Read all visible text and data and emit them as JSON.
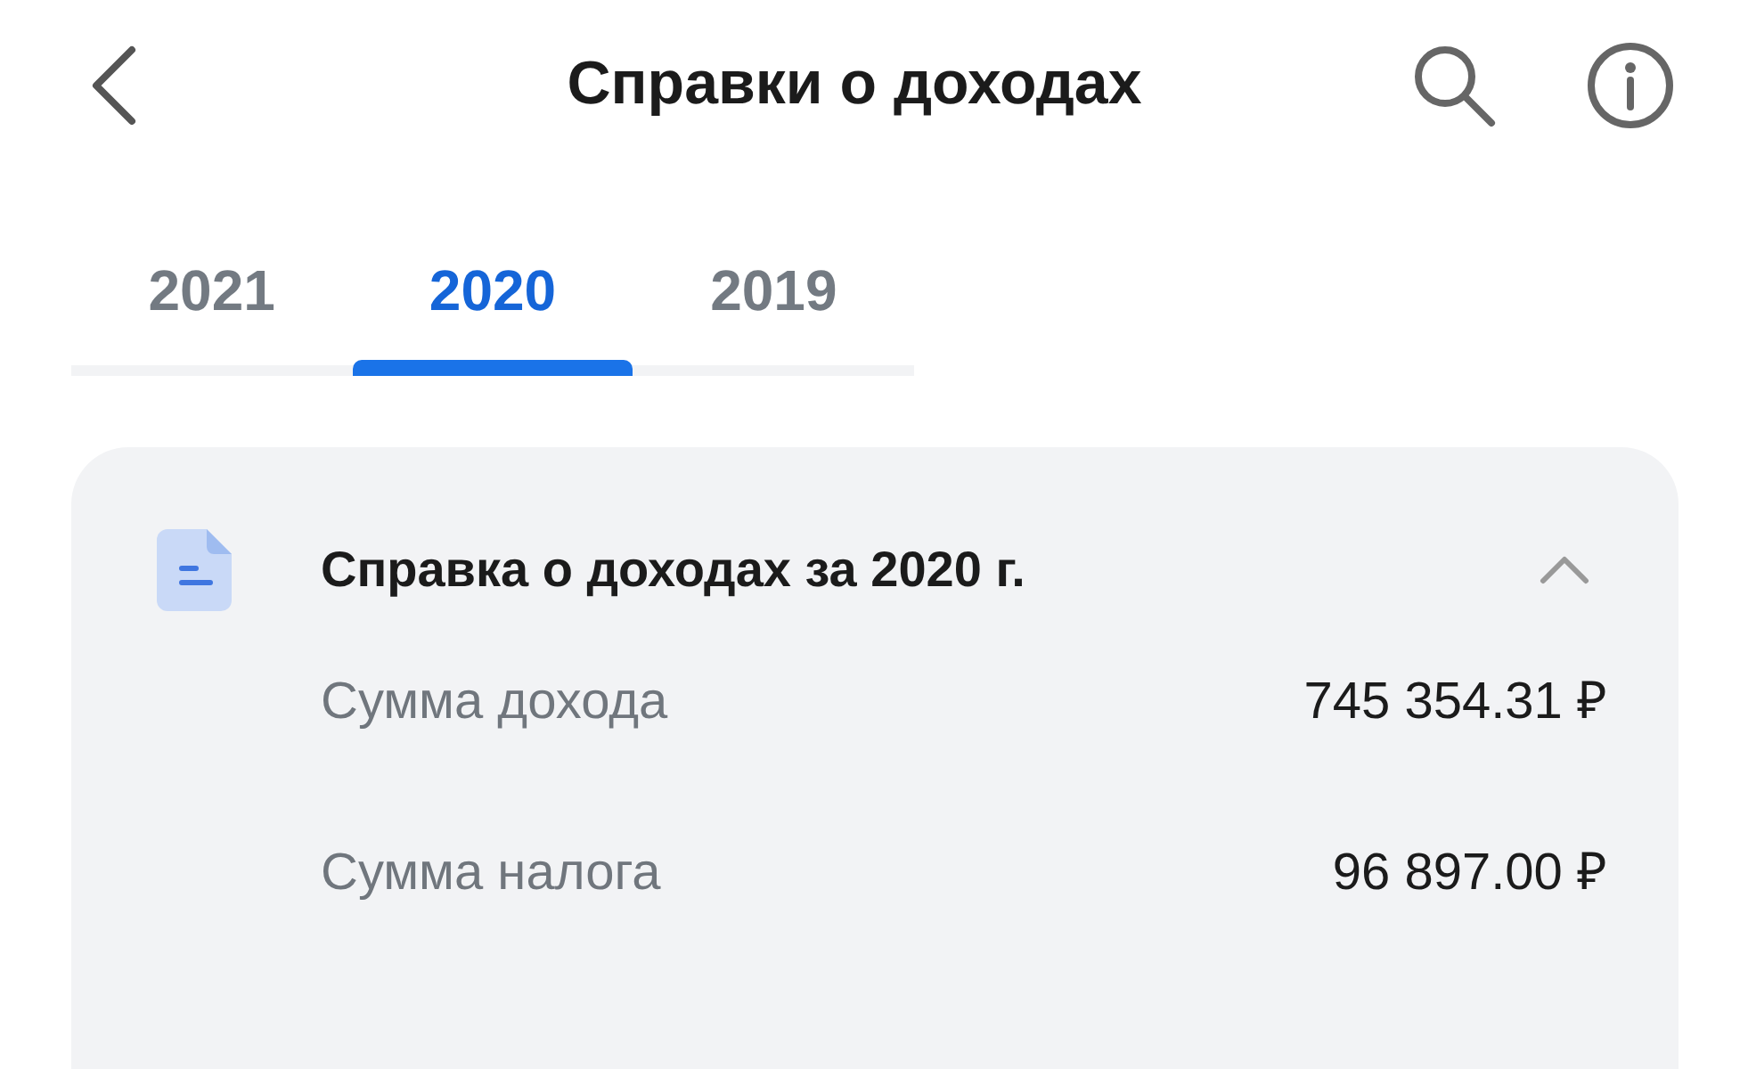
{
  "header": {
    "title": "Справки о доходах"
  },
  "tabs": [
    {
      "label": "2021",
      "selected": false
    },
    {
      "label": "2020",
      "selected": true
    },
    {
      "label": "2019",
      "selected": false
    }
  ],
  "certificate": {
    "title": "Справка о доходах за 2020 г.",
    "expanded": true,
    "rows": [
      {
        "label": "Сумма дохода",
        "value": "745 354.31 ₽"
      },
      {
        "label": "Сумма налога",
        "value": "96 897.00 ₽"
      }
    ]
  }
}
